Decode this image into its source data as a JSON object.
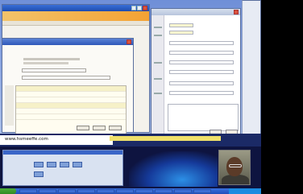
{
  "desktop": {
    "website_text": "www.hsmeeffe.com"
  },
  "windows": {
    "back": {
      "title": ""
    },
    "main": {
      "title": "",
      "heading": ""
    },
    "right": {
      "title": ""
    }
  },
  "taskbar": {
    "start_label": "",
    "tasks": [
      "",
      "",
      "",
      "",
      "",
      "",
      "",
      "",
      "",
      ""
    ]
  },
  "colors": {
    "accent": "#1f4fba",
    "titlebar": "#2f58b8",
    "orange_header": "#f4a233",
    "notice_yellow": "#efe06a"
  }
}
